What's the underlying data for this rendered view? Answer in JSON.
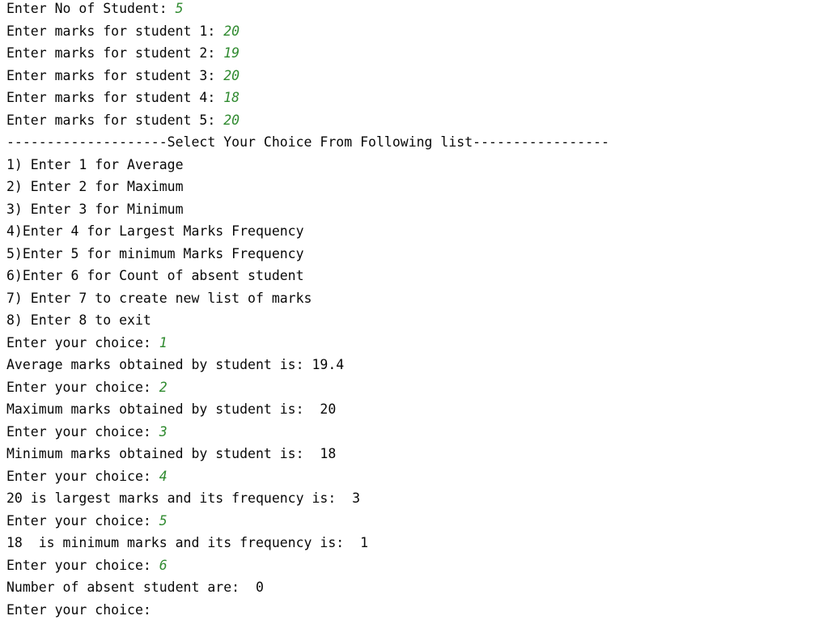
{
  "colors": {
    "background": "#ffffff",
    "output_text": "#080808",
    "user_input": "#2f8a2f"
  },
  "console": {
    "lines": [
      {
        "text": "Enter No of Student: ",
        "input": "5"
      },
      {
        "text": "Enter marks for student 1: ",
        "input": "20"
      },
      {
        "text": "Enter marks for student 2: ",
        "input": "19"
      },
      {
        "text": "Enter marks for student 3: ",
        "input": "20"
      },
      {
        "text": "Enter marks for student 4: ",
        "input": "18"
      },
      {
        "text": "Enter marks for student 5: ",
        "input": "20"
      },
      {
        "text": "--------------------Select Your Choice From Following list-----------------",
        "input": ""
      },
      {
        "text": "1) Enter 1 for Average",
        "input": ""
      },
      {
        "text": "2) Enter 2 for Maximum",
        "input": ""
      },
      {
        "text": "3) Enter 3 for Minimum",
        "input": ""
      },
      {
        "text": "4)Enter 4 for Largest Marks Frequency",
        "input": ""
      },
      {
        "text": "5)Enter 5 for minimum Marks Frequency",
        "input": ""
      },
      {
        "text": "6)Enter 6 for Count of absent student",
        "input": ""
      },
      {
        "text": "7) Enter 7 to create new list of marks",
        "input": ""
      },
      {
        "text": "8) Enter 8 to exit",
        "input": ""
      },
      {
        "text": "Enter your choice: ",
        "input": "1"
      },
      {
        "text": "Average marks obtained by student is: 19.4",
        "input": ""
      },
      {
        "text": "Enter your choice: ",
        "input": "2"
      },
      {
        "text": "Maximum marks obtained by student is:  20",
        "input": ""
      },
      {
        "text": "Enter your choice: ",
        "input": "3"
      },
      {
        "text": "Minimum marks obtained by student is:  18",
        "input": ""
      },
      {
        "text": "Enter your choice: ",
        "input": "4"
      },
      {
        "text": "20 is largest marks and its frequency is:  3",
        "input": ""
      },
      {
        "text": "Enter your choice: ",
        "input": "5"
      },
      {
        "text": "18  is minimum marks and its frequency is:  1",
        "input": ""
      },
      {
        "text": "Enter your choice: ",
        "input": "6"
      },
      {
        "text": "Number of absent student are:  0",
        "input": ""
      },
      {
        "text": "Enter your choice: ",
        "input": ""
      }
    ]
  }
}
